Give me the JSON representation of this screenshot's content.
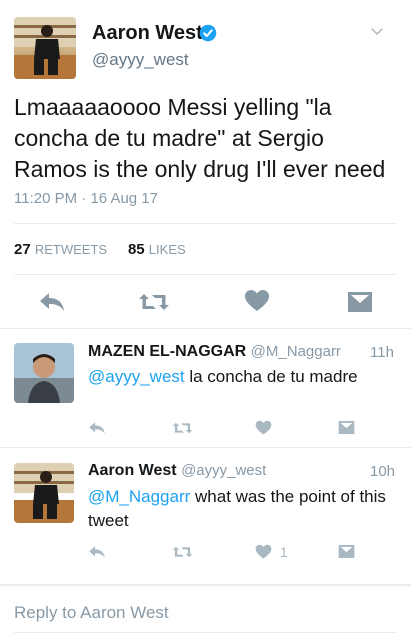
{
  "tweet": {
    "author_name": "Aaron West",
    "author_handle": "@ayyy_west",
    "text": "Lmaaaaaoooo Messi yelling \"la concha de tu madre\" at Sergio Ramos is the only drug I'll ever need",
    "timestamp": "11:20 PM · 16 Aug 17",
    "retweets_count": "27",
    "retweets_label": "RETWEETS",
    "likes_count": "85",
    "likes_label": "LIKES"
  },
  "replies": [
    {
      "name": "MAZEN EL-NAGGAR",
      "handle": "@M_Naggarr",
      "time": "11h",
      "mention": "@ayyy_west",
      "text": " la concha de tu madre",
      "like_count": ""
    },
    {
      "name": "Aaron West",
      "handle": "@ayyy_west",
      "time": "10h",
      "mention": "@M_Naggarr",
      "text": " what was the point of this tweet",
      "like_count": "1"
    }
  ],
  "reply_box": {
    "placeholder": "Reply to Aaron West"
  },
  "icons": [
    "verified-icon",
    "chevron-down-icon",
    "reply-icon",
    "retweet-icon",
    "like-icon",
    "direct-message-icon"
  ],
  "colors": {
    "accent": "#1da1f2",
    "muted": "#8899a6",
    "text": "#14171a"
  }
}
